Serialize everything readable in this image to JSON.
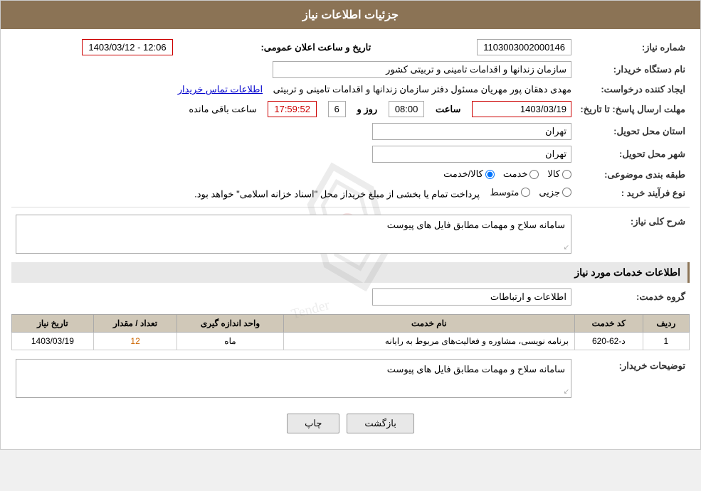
{
  "page": {
    "title": "جزئیات اطلاعات نیاز"
  },
  "fields": {
    "request_number_label": "شماره نیاز:",
    "request_number_value": "1103003002000146",
    "org_name_label": "نام دستگاه خریدار:",
    "org_name_value": "سازمان زندانها و اقدامات تامینی و تربیتی کشور",
    "requester_label": "ایجاد کننده درخواست:",
    "requester_value": "مهدی  دهقان پور مهریان مسئول دفتر سازمان زندانها و اقدامات تامینی و تربیتی",
    "requester_link": "اطلاعات تماس خریدار",
    "deadline_label": "مهلت ارسال پاسخ: تا تاریخ:",
    "deadline_date": "1403/03/19",
    "deadline_time": "08:00",
    "deadline_days": "6",
    "deadline_clock": "17:59:52",
    "remaining_label": "ساعت باقی مانده",
    "days_label": "روز و",
    "time_label": "ساعت",
    "province_label": "استان محل تحویل:",
    "province_value": "تهران",
    "city_label": "شهر محل تحویل:",
    "city_value": "تهران",
    "category_label": "طبقه بندی موضوعی:",
    "category_options": [
      "کالا",
      "خدمت",
      "کالا/خدمت"
    ],
    "category_selected": "کالا/خدمت",
    "purchase_type_label": "نوع فرآیند خرید :",
    "purchase_type_options": [
      "جزیی",
      "متوسط"
    ],
    "purchase_type_note": "پرداخت تمام یا بخشی از مبلغ خریداز محل \"اسناد خزانه اسلامی\" خواهد بود.",
    "description_label": "شرح کلی نیاز:",
    "description_value": "سامانه سلاح و مهمات مطابق فایل های پیوست",
    "services_title": "اطلاعات خدمات مورد نیاز",
    "service_group_label": "گروه خدمت:",
    "service_group_value": "اطلاعات و ارتباطات",
    "table": {
      "headers": [
        "ردیف",
        "کد خدمت",
        "نام خدمت",
        "واحد اندازه گیری",
        "تعداد / مقدار",
        "تاریخ نیاز"
      ],
      "rows": [
        {
          "row": "1",
          "code": "د-62-620",
          "name": "برنامه نویسی، مشاوره و فعالیت‌های مربوط به رایانه",
          "unit": "ماه",
          "quantity": "12",
          "date": "1403/03/19"
        }
      ]
    },
    "buyer_desc_label": "توضیحات خریدار:",
    "buyer_desc_value": "سامانه سلاح و مهمات مطابق فایل های پیوست",
    "announcement_datetime_label": "تاریخ و ساعت اعلان عمومی:",
    "announcement_datetime_value": "1403/03/12 - 12:06"
  },
  "buttons": {
    "print_label": "چاپ",
    "back_label": "بازگشت"
  }
}
